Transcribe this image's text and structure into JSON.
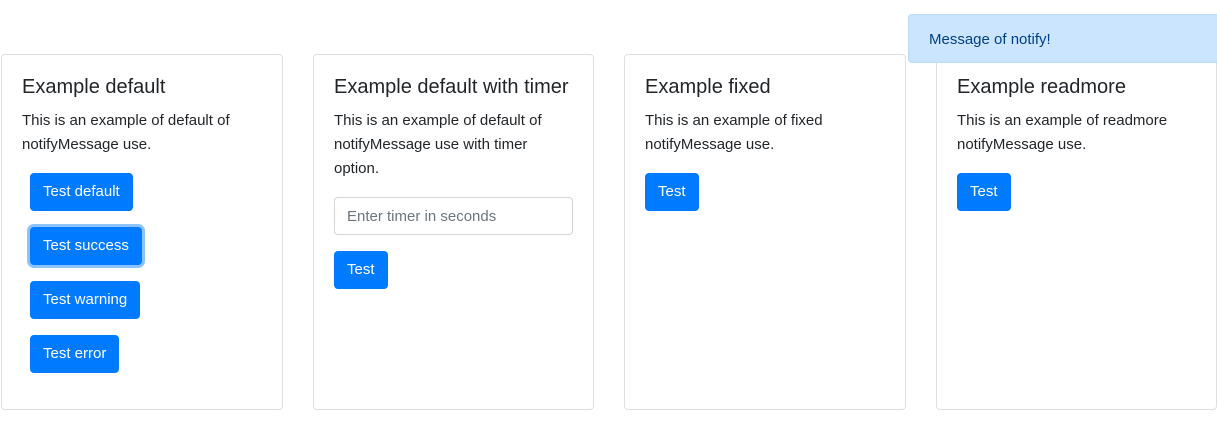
{
  "cards": [
    {
      "title": "Example default",
      "text": "This is an example of default of notifyMessage use.",
      "buttons": [
        "Test default",
        "Test success",
        "Test warning",
        "Test error"
      ]
    },
    {
      "title": "Example default with timer",
      "text": "This is an example of default of notifyMessage use with timer option.",
      "input_placeholder": "Enter timer in seconds",
      "button": "Test"
    },
    {
      "title": "Example fixed",
      "text": "This is an example of fixed notifyMessage use.",
      "button": "Test"
    },
    {
      "title": "Example readmore",
      "text": "This is an example of readmore notifyMessage use.",
      "button": "Test"
    }
  ],
  "notification": {
    "message": "Message of notify!"
  },
  "colors": {
    "primary": "#007bff",
    "notify_bg": "#cce5ff",
    "notify_text": "#004085"
  }
}
